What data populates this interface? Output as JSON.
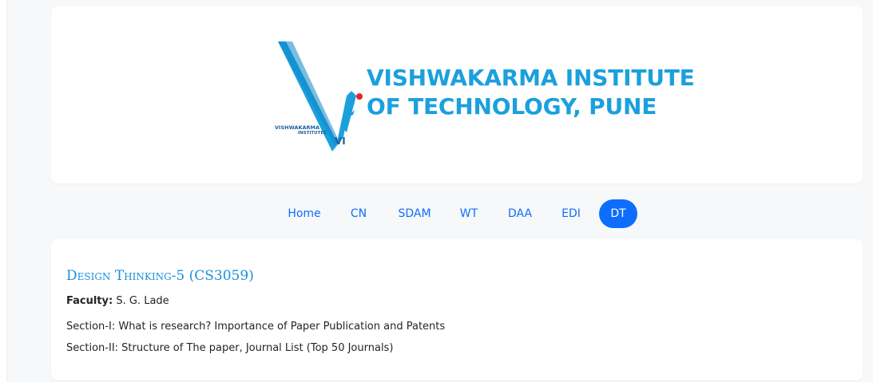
{
  "header": {
    "logo": {
      "line1": "VISHWAKARMA INSTITUTE",
      "line2": "OF TECHNOLOGY, PUNE",
      "seal_line1": "VISHWAKARMA",
      "seal_line2": "INSTITUTES",
      "seal_mark": "VI",
      "brand_color": "#1ba0dd",
      "accent_dot_color": "#e3262e"
    }
  },
  "nav": {
    "items": [
      {
        "label": "Home"
      },
      {
        "label": "CN"
      },
      {
        "label": "SDAM"
      },
      {
        "label": "WT"
      },
      {
        "label": "DAA"
      },
      {
        "label": "EDI"
      },
      {
        "label": "DT"
      }
    ],
    "active": "DT",
    "accent_color": "#0d6efd"
  },
  "course": {
    "title": "Design Thinking-5 (CS3059)",
    "faculty_label": "Faculty:",
    "faculty_name": "S. G. Lade",
    "sections": [
      "Section-I: What is research? Importance of Paper Publication and Patents",
      "Section-II: Structure of The paper, Journal List (Top 50 Journals)"
    ]
  }
}
